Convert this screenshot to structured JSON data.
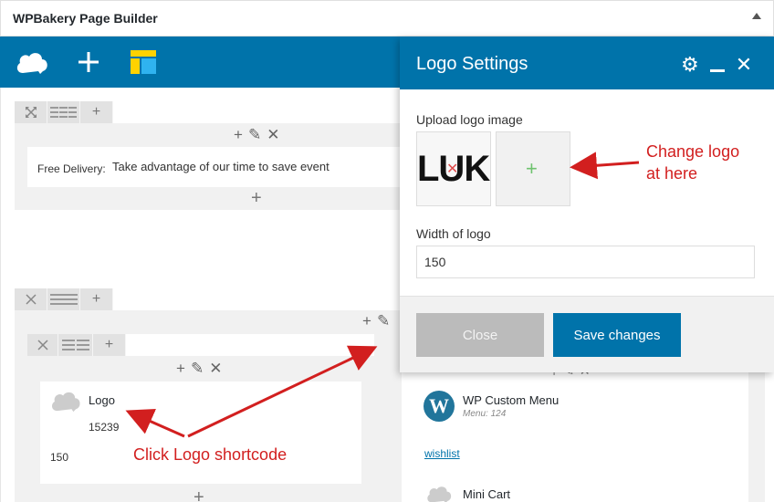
{
  "panel": {
    "title": "WPBakery Page Builder"
  },
  "row1": {
    "element": {
      "label": "Free Delivery:",
      "text": "Take advantage of our time to save event"
    }
  },
  "row2": {
    "logo_element": {
      "title": "Logo",
      "id": "15239",
      "width": "150"
    },
    "menu_element": {
      "title": "WP Custom Menu",
      "meta": "Menu: 124"
    },
    "wishlist_link": "wishlist",
    "minicart_element": {
      "title": "Mini Cart"
    }
  },
  "modal": {
    "title": "Logo Settings",
    "upload_label": "Upload logo image",
    "thumb_text": "LUK",
    "width_label": "Width of logo",
    "width_value": "150",
    "close_label": "Close",
    "save_label": "Save changes"
  },
  "annotations": {
    "change_logo_1": "Change logo",
    "change_logo_2": "at here",
    "click_logo": "Click Logo shortcode"
  },
  "colors": {
    "brand": "#0073aa",
    "annotation": "#d21f1f"
  }
}
